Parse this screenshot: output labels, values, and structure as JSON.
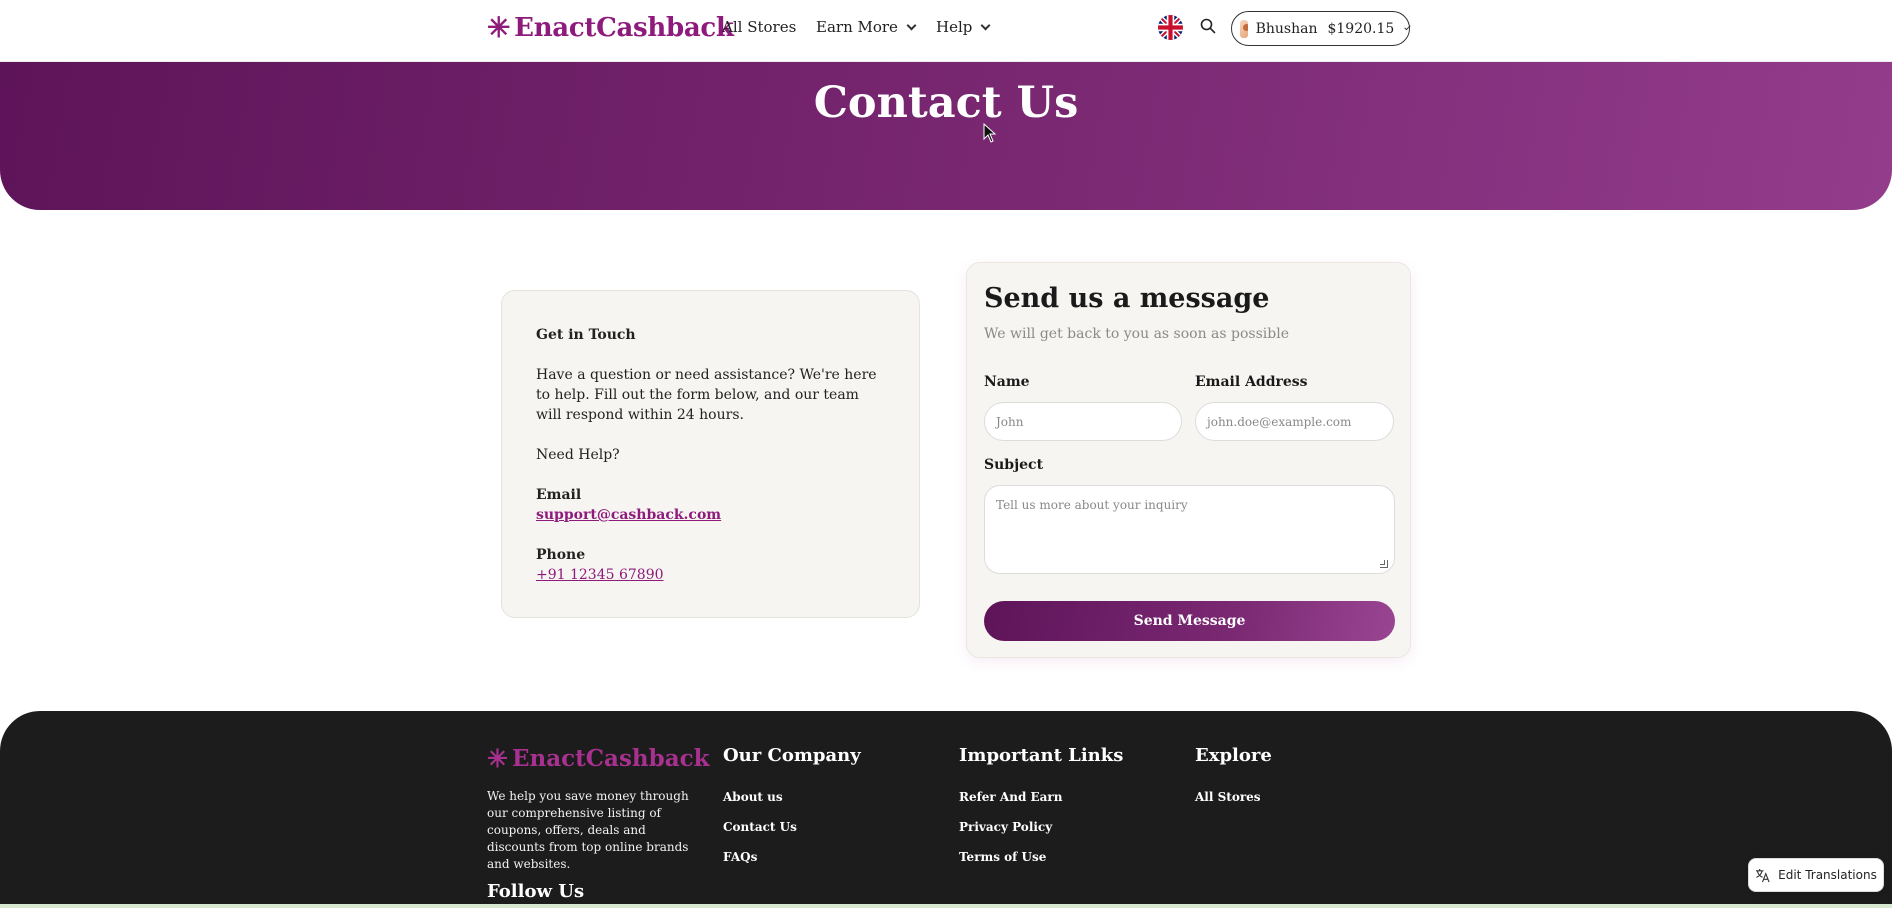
{
  "nav": {
    "brand": "EnactCashback",
    "links": [
      "All Stores",
      "Earn More",
      "Help"
    ],
    "user": {
      "name": "Bhushan",
      "balance": "$1920.15"
    }
  },
  "hero": {
    "title": "Contact Us"
  },
  "info": {
    "heading": "Get in Touch",
    "body": "Have a question or need assistance? We're here to help. Fill out the form below, and our team will respond within 24 hours.",
    "need_help": "Need Help?",
    "email_label": "Email",
    "email_value": "support@cashback.com",
    "phone_label": "Phone",
    "phone_value": "+91 12345 67890"
  },
  "form": {
    "title": "Send us a message",
    "subtitle": "We will get back to you as soon as possible",
    "name_label": "Name",
    "name_placeholder": "John",
    "email_label": "Email Address",
    "email_placeholder": "john.doe@example.com",
    "subject_label": "Subject",
    "subject_placeholder": "Tell us more about your inquiry",
    "submit": "Send Message"
  },
  "footer": {
    "brand": "EnactCashback",
    "description": "We help you save money through our comprehensive listing of coupons, offers, deals and discounts from top online brands and websites.",
    "columns": [
      {
        "title": "Our Company",
        "links": [
          "About us",
          "Contact Us",
          "FAQs"
        ]
      },
      {
        "title": "Important Links",
        "links": [
          "Refer And Earn",
          "Privacy Policy",
          "Terms of Use"
        ]
      },
      {
        "title": "Explore",
        "links": [
          "All Stores"
        ]
      }
    ],
    "follow": "Follow Us"
  },
  "translate_button": "Edit Translations",
  "colors": {
    "brand": "#8e1a7c",
    "hero_start": "#5e1459",
    "hero_end": "#933c8c",
    "footer_bg": "#1c1c1c"
  }
}
